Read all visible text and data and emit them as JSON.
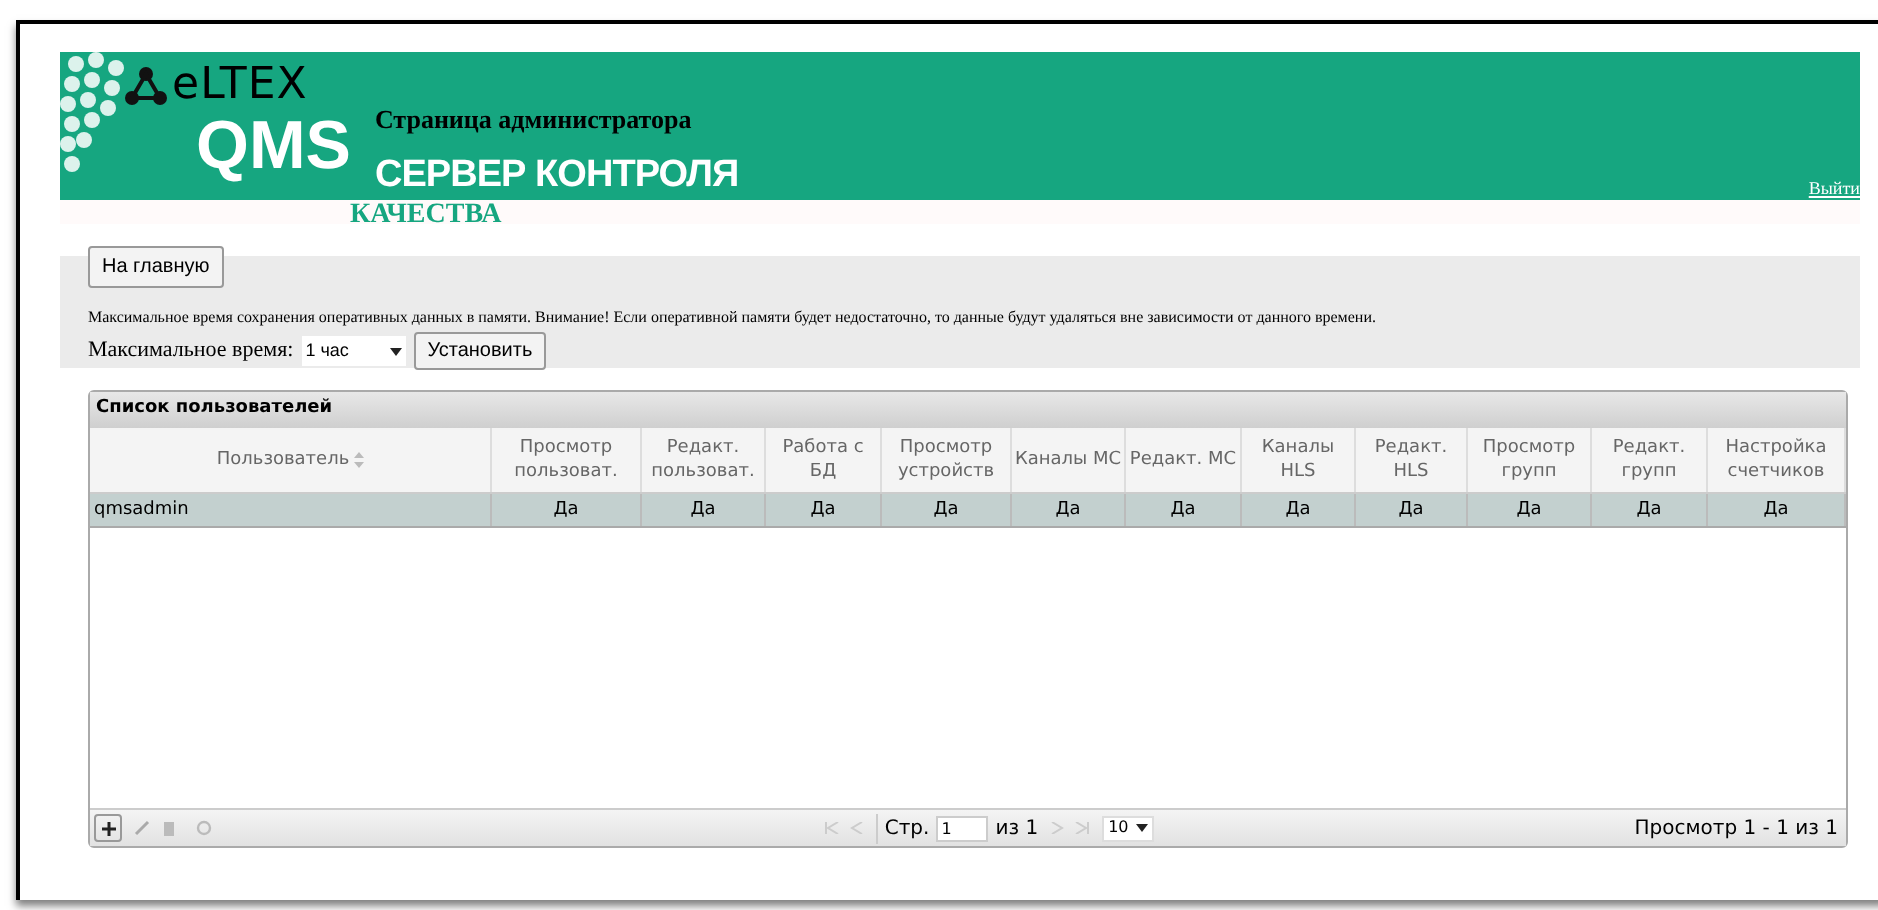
{
  "header": {
    "brand": "eLTEX",
    "product": "QMS",
    "subtitle": "Страница администратора",
    "title_line_1": "СЕРВЕР КОНТРОЛЯ",
    "title_line_2": "КАЧЕСТВА",
    "logout": "Выйти"
  },
  "home_button": "На главную",
  "settings": {
    "note": "Максимальное время сохранения оперативных данных в памяти. Внимание! Если оперативной памяти будет недостаточно, то данные будут удаляться вне зависимости от данного времени.",
    "label": "Максимальное время:",
    "value": "1 час",
    "button": "Установить"
  },
  "table": {
    "caption": "Список пользователей",
    "columns": [
      {
        "label": "Пользователь",
        "sortable": true
      },
      {
        "label": "Просмотр пользоват.",
        "sortable": false
      },
      {
        "label": "Редакт. пользоват.",
        "sortable": false
      },
      {
        "label": "Работа с БД",
        "sortable": false
      },
      {
        "label": "Просмотр устройств",
        "sortable": false
      },
      {
        "label": "Каналы MC",
        "sortable": false
      },
      {
        "label": "Редакт. MC",
        "sortable": false
      },
      {
        "label": "Каналы HLS",
        "sortable": false
      },
      {
        "label": "Редакт. HLS",
        "sortable": false
      },
      {
        "label": "Просмотр групп",
        "sortable": false
      },
      {
        "label": "Редакт. групп",
        "sortable": false
      },
      {
        "label": "Настройка счетчиков",
        "sortable": false
      }
    ],
    "rows": [
      {
        "selected": true,
        "cells": [
          "qmsadmin",
          "Да",
          "Да",
          "Да",
          "Да",
          "Да",
          "Да",
          "Да",
          "Да",
          "Да",
          "Да",
          "Да"
        ]
      }
    ]
  },
  "pager": {
    "page_label": "Стр.",
    "page": "1",
    "of": "из 1",
    "page_size": "10",
    "summary": "Просмотр 1 - 1 из 1"
  }
}
